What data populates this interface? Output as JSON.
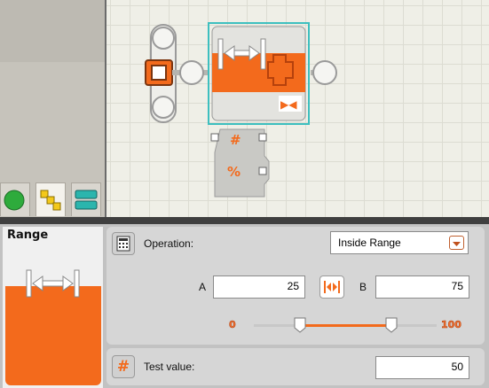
{
  "block": {
    "name": "Range"
  },
  "config": {
    "operation_label": "Operation:",
    "operation_value": "Inside Range",
    "a_label": "A",
    "a_value": "25",
    "b_label": "B",
    "b_value": "75",
    "slider": {
      "min_label": "0",
      "max_label": "100",
      "min": 0,
      "max": 100,
      "low": 25,
      "high": 75
    },
    "test_label": "Test value:",
    "test_value": "50"
  },
  "palette_tabs": [
    {
      "icon": "green-circle-icon",
      "selected": false
    },
    {
      "icon": "complete-palette-icon",
      "selected": true
    },
    {
      "icon": "custom-palette-icon",
      "selected": false
    }
  ],
  "colors": {
    "accent": "#f36a1c",
    "selection": "#3dbfbf",
    "separator": "#3f3f3f"
  },
  "icons": [
    "calculator-icon",
    "range-icon",
    "hash-icon",
    "chevron-down-icon",
    "swap-icon",
    "slider-thumb-icon"
  ]
}
